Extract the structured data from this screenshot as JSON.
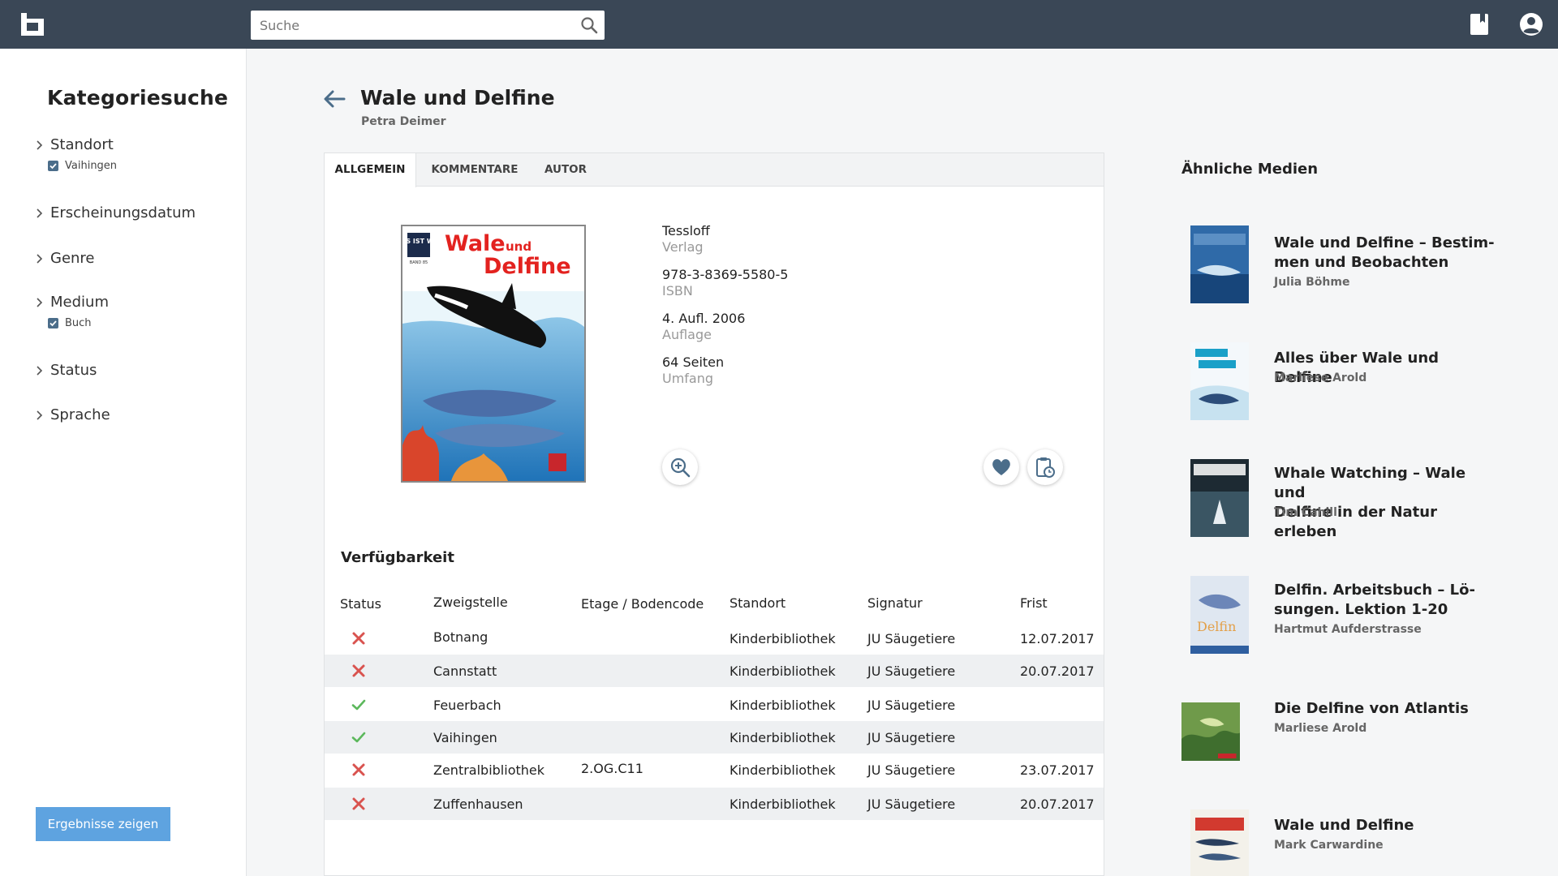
{
  "search": {
    "placeholder": "Suche"
  },
  "sidebar": {
    "title": "Kategoriesuche",
    "categories": [
      {
        "label": "Standort",
        "selected": "Vaihingen"
      },
      {
        "label": "Erscheinungsdatum"
      },
      {
        "label": "Genre"
      },
      {
        "label": "Medium",
        "selected": "Buch"
      },
      {
        "label": "Status"
      },
      {
        "label": "Sprache"
      }
    ],
    "apply_label": "Ergebnisse zeigen"
  },
  "book": {
    "title": "Wale und Delfine",
    "author": "Petra Deimer",
    "cover": {
      "series": "WAS IST WAS",
      "title_line1": "Wale",
      "title_und": "und",
      "title_line2": "Delfine",
      "band": "BAND 85"
    },
    "tabs": [
      "ALLGEMEIN",
      "KOMMENTARE",
      "AUTOR"
    ],
    "meta": [
      {
        "value": "Tessloff",
        "label": "Verlag"
      },
      {
        "value": "978-3-8369-5580-5",
        "label": "ISBN"
      },
      {
        "value": "4. Aufl. 2006",
        "label": "Auflage"
      },
      {
        "value": "64 Seiten",
        "label": "Umfang"
      }
    ]
  },
  "availability": {
    "title": "Verfügbarkeit",
    "headers": [
      "Status",
      "Zweigstelle",
      "Etage / Bodencode",
      "Standort",
      "Signatur",
      "Frist"
    ],
    "rows": [
      {
        "status": "unavailable",
        "branch": "Botnang",
        "floor": "",
        "location": "Kinderbibliothek",
        "signature": "JU Säugetiere",
        "due": "12.07.2017"
      },
      {
        "status": "unavailable",
        "branch": "Cannstatt",
        "floor": "",
        "location": "Kinderbibliothek",
        "signature": "JU Säugetiere",
        "due": "20.07.2017"
      },
      {
        "status": "available",
        "branch": "Feuerbach",
        "floor": "",
        "location": "Kinderbibliothek",
        "signature": "JU Säugetiere",
        "due": ""
      },
      {
        "status": "available",
        "branch": "Vaihingen",
        "floor": "",
        "location": "Kinderbibliothek",
        "signature": "JU Säugetiere",
        "due": ""
      },
      {
        "status": "unavailable",
        "branch": "Zentralbibliothek",
        "floor": "2.OG.C11",
        "location": "Kinderbibliothek",
        "signature": "JU Säugetiere",
        "due": "23.07.2017"
      },
      {
        "status": "unavailable",
        "branch": "Zuffenhausen",
        "floor": "",
        "location": "Kinderbibliothek",
        "signature": "JU Säugetiere",
        "due": "20.07.2017"
      }
    ]
  },
  "similar": {
    "title": "Ähnliche Medien",
    "items": [
      {
        "title_lines": [
          "Wale und Delfine – Bestim-",
          "men und Beobachten"
        ],
        "author": "Julia Böhme"
      },
      {
        "title_lines": [
          "Alles über Wale und Delfine"
        ],
        "author": "Marliese Arold"
      },
      {
        "title_lines": [
          "Whale Watching – Wale und",
          "Delfine in der Natur erleben"
        ],
        "author": "Tim Cahill"
      },
      {
        "title_lines": [
          "Delfin. Arbeitsbuch – Lö-",
          "sungen. Lektion 1-20"
        ],
        "author": "Hartmut Aufderstrasse"
      },
      {
        "title_lines": [
          "Die Delfine von Atlantis"
        ],
        "author": "Marliese Arold"
      },
      {
        "title_lines": [
          "Wale und Delfine"
        ],
        "author": "Mark Carwardine"
      }
    ]
  },
  "colors": {
    "topbar": "#3a4756",
    "accent": "#5ea3e0",
    "unavailable": "#d9534f",
    "available": "#5cb85c"
  }
}
